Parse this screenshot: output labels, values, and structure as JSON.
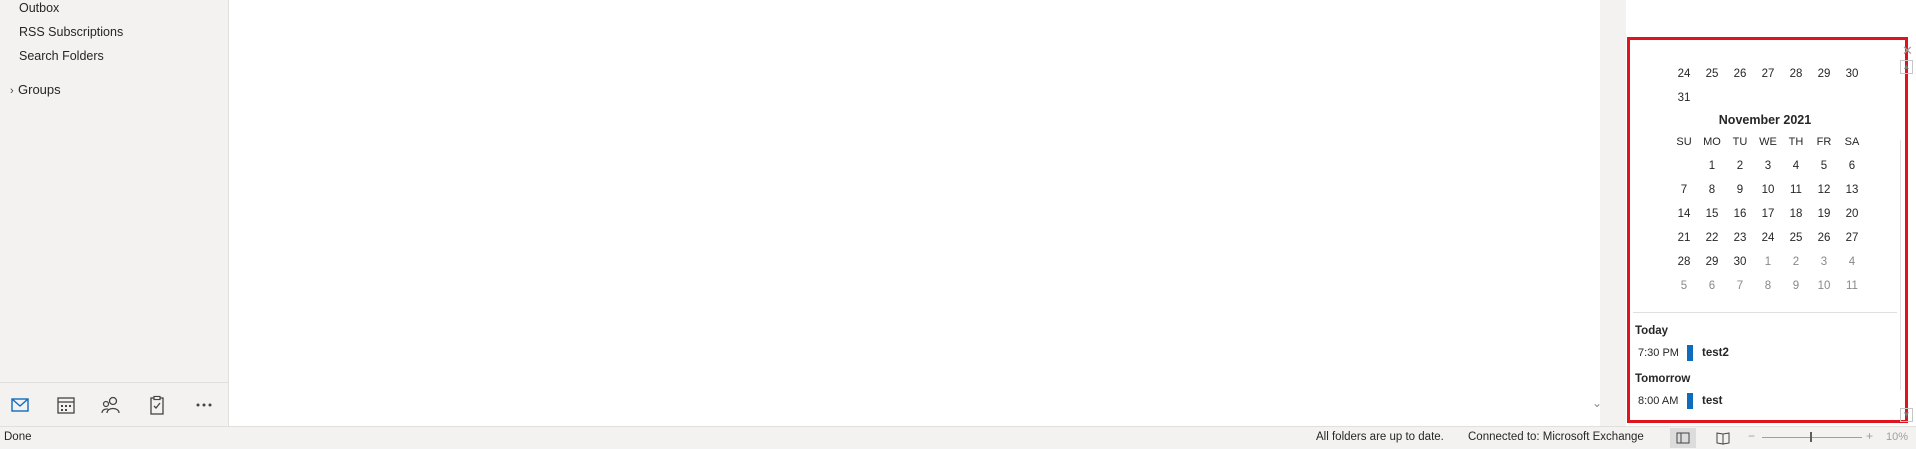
{
  "folders": {
    "items": [
      "Outbox",
      "RSS Subscriptions",
      "Search Folders"
    ],
    "groups_label": "Groups"
  },
  "nav_icons": [
    "mail-icon",
    "calendar-icon",
    "people-icon",
    "tasks-icon",
    "more-icon"
  ],
  "calendar": {
    "prev_week": [
      "24",
      "25",
      "26",
      "27",
      "28",
      "29",
      "30"
    ],
    "prev_extra": [
      "31"
    ],
    "month_title": "November 2021",
    "weekdays": [
      "SU",
      "MO",
      "TU",
      "WE",
      "TH",
      "FR",
      "SA"
    ],
    "weeks": [
      [
        "",
        "1",
        "2",
        "3",
        "4",
        "5",
        "6"
      ],
      [
        "7",
        "8",
        "9",
        "10",
        "11",
        "12",
        "13"
      ],
      [
        "14",
        "15",
        "16",
        "17",
        "18",
        "19",
        "20"
      ],
      [
        "21",
        "22",
        "23",
        "24",
        "25",
        "26",
        "27"
      ],
      [
        "28",
        "29",
        "30",
        "1",
        "2",
        "3",
        "4"
      ],
      [
        "5",
        "6",
        "7",
        "8",
        "9",
        "10",
        "11"
      ]
    ]
  },
  "agenda": {
    "today": {
      "heading": "Today",
      "time": "7:30 PM",
      "title": "test2"
    },
    "tomorrow": {
      "heading": "Tomorrow",
      "time": "8:00 AM",
      "title": "test"
    }
  },
  "status": {
    "left": "Done",
    "sync": "All folders are up to date.",
    "connection": "Connected to: Microsoft Exchange",
    "zoom": "10%",
    "zoom_minus": "−",
    "zoom_plus": "+"
  },
  "colors": {
    "highlight": "#e0141e",
    "accent": "#0f6cbd"
  }
}
